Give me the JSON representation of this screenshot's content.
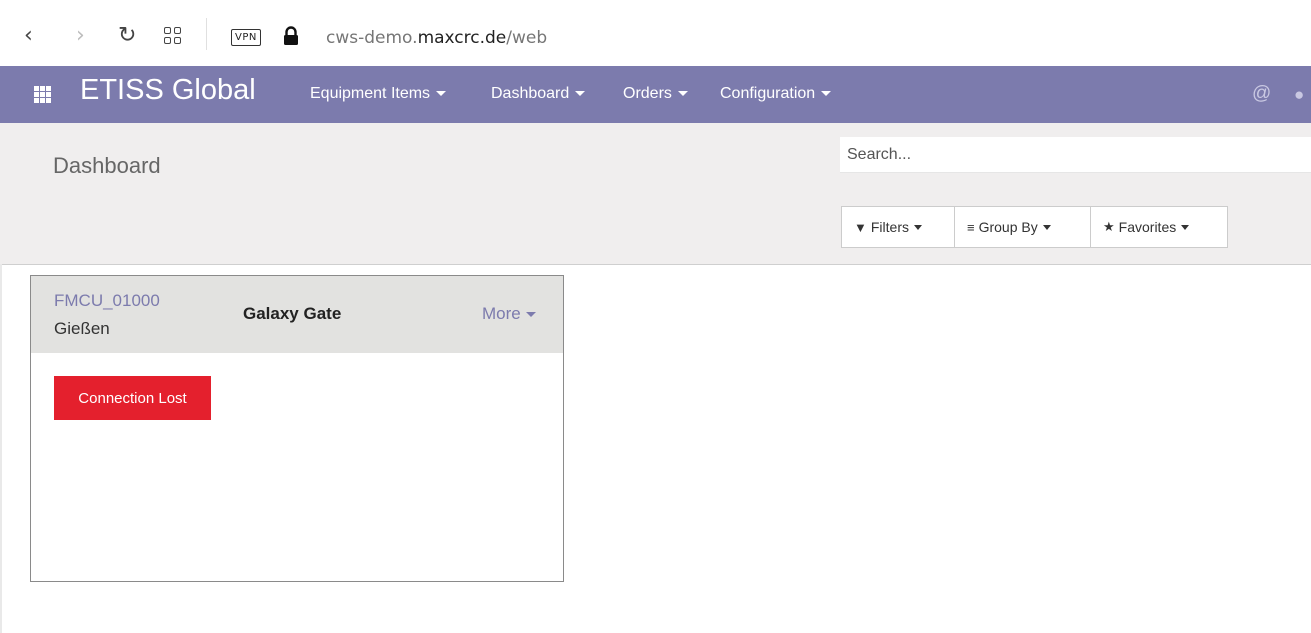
{
  "browser": {
    "back_icon": "chevron-left-icon",
    "forward_icon": "chevron-right-icon",
    "reload_icon": "reload-icon",
    "vpn_badge": "VPN",
    "url_prefix": "cws-demo.",
    "url_host": "maxcrc.de",
    "url_path": "/web"
  },
  "nav": {
    "brand": "ETISS Global",
    "menu": [
      {
        "label": "Equipment Items"
      },
      {
        "label": "Dashboard"
      },
      {
        "label": "Orders"
      },
      {
        "label": "Configuration"
      }
    ],
    "at_icon": "@",
    "chat_icon": "chat-icon",
    "color": "#7c7bad"
  },
  "control_panel": {
    "title": "Dashboard",
    "search_placeholder": "Search...",
    "filters_label": "Filters",
    "group_by_label": "Group By",
    "favorites_label": "Favorites"
  },
  "card": {
    "id": "FMCU_01000",
    "city": "Gießen",
    "name": "Galaxy Gate",
    "more_label": "More",
    "status_label": "Connection Lost",
    "status_color": "#e4202d"
  }
}
